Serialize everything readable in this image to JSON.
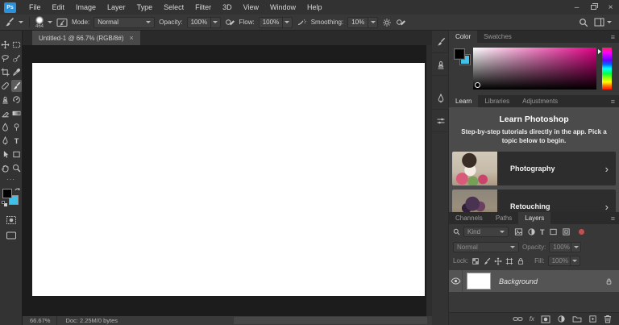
{
  "app": {
    "logo_text": "Ps"
  },
  "menubar": {
    "items": [
      "File",
      "Edit",
      "Image",
      "Layer",
      "Type",
      "Select",
      "Filter",
      "3D",
      "View",
      "Window",
      "Help"
    ]
  },
  "window_controls": {
    "minimize": "–",
    "close": "×"
  },
  "options": {
    "brush_size": "464",
    "mode_label": "Mode:",
    "mode_value": "Normal",
    "opacity_label": "Opacity:",
    "opacity_value": "100%",
    "flow_label": "Flow:",
    "flow_value": "100%",
    "smoothing_label": "Smoothing:",
    "smoothing_value": "10%"
  },
  "document": {
    "tab_title": "Untitled-1 @ 66.7% (RGB/8#)",
    "tab_close": "×"
  },
  "status": {
    "zoom": "66.67%",
    "doc_info": "Doc: 2.25M/0 bytes"
  },
  "colors": {
    "foreground": "#000000",
    "background": "#3fc1ea",
    "selection_row": "#545454"
  },
  "glyphs": {
    "ellipsis": "···",
    "panel_menu": "≡",
    "chevron": "›",
    "type_tool": "T",
    "fx": "fx"
  },
  "color_panel": {
    "tabs": [
      "Color",
      "Swatches"
    ]
  },
  "learn_panel": {
    "tabs": [
      "Learn",
      "Libraries",
      "Adjustments"
    ],
    "title": "Learn Photoshop",
    "subtitle": "Step-by-step tutorials directly in the app. Pick a topic below to begin.",
    "topics": [
      {
        "label": "Photography"
      },
      {
        "label": "Retouching"
      }
    ]
  },
  "layers_panel": {
    "tabs": [
      "Channels",
      "Paths",
      "Layers"
    ],
    "filter_value": "Kind",
    "blend_mode": "Normal",
    "opacity_label": "Opacity:",
    "opacity_value": "100%",
    "lock_label": "Lock:",
    "fill_label": "Fill:",
    "fill_value": "100%",
    "layers": [
      {
        "name": "Background"
      }
    ]
  }
}
